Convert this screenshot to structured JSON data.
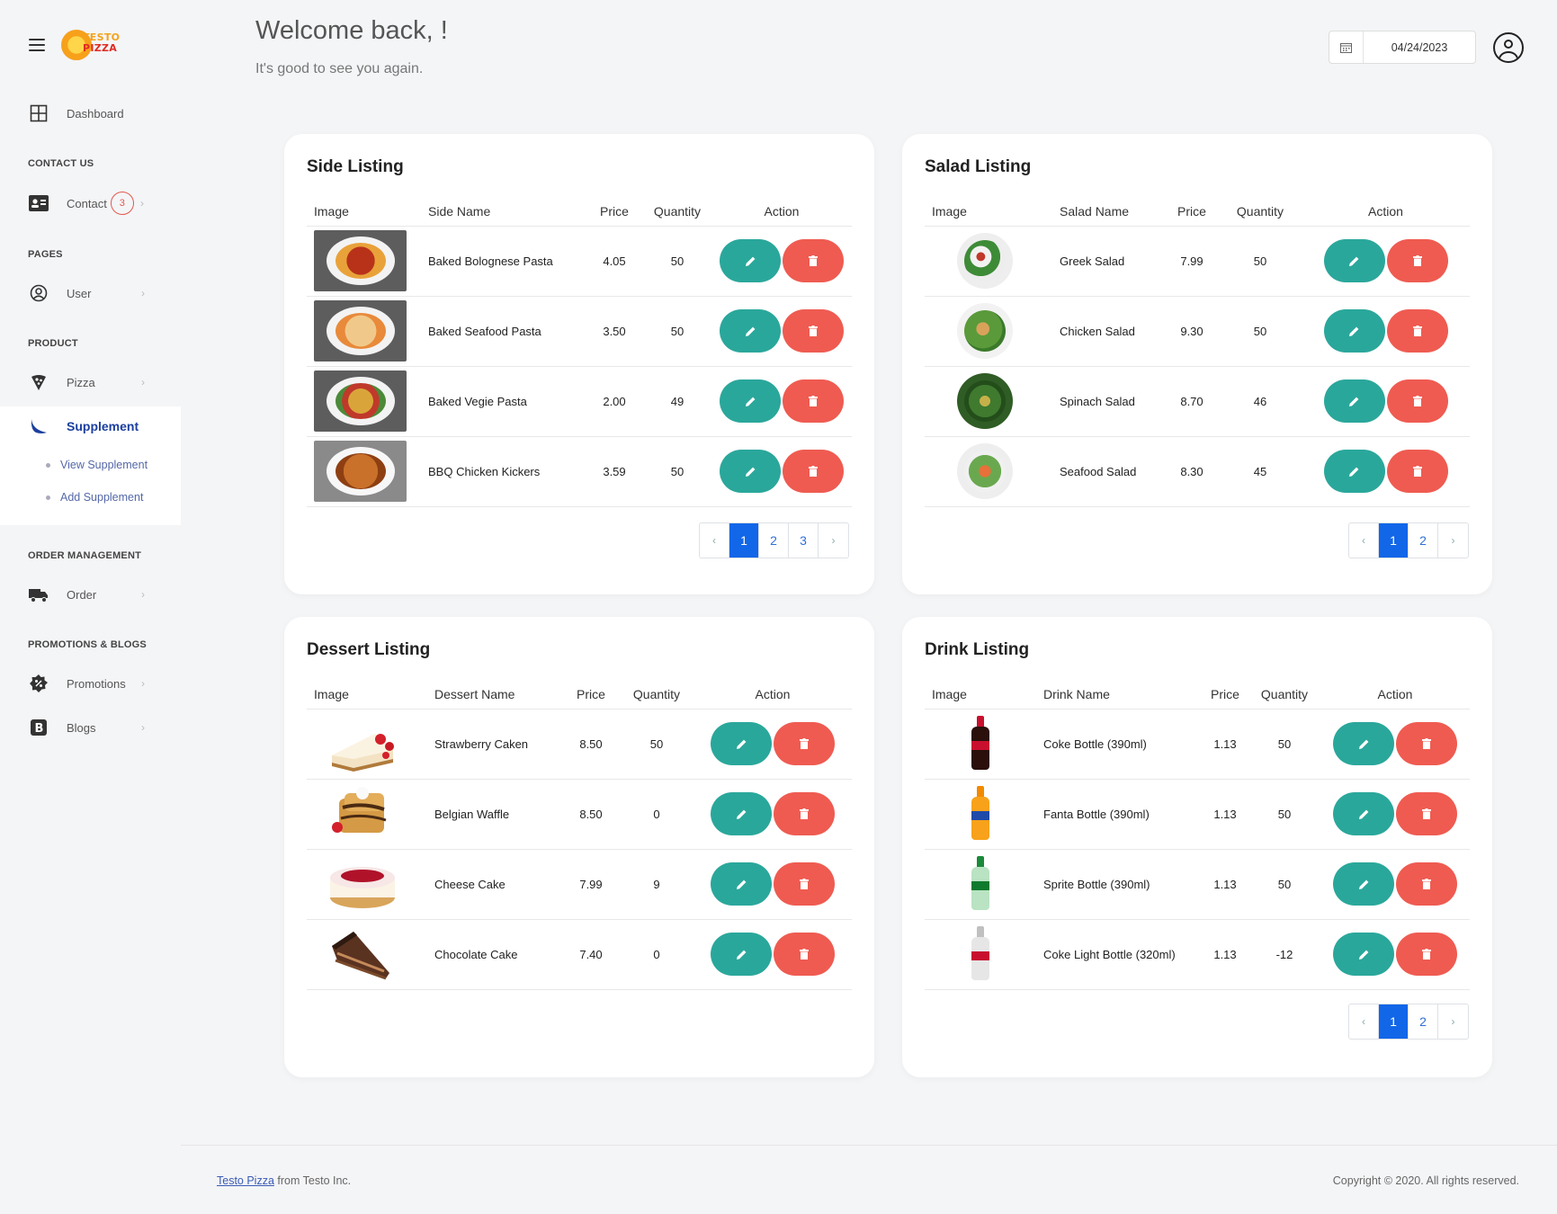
{
  "sidebar": {
    "logo_line1": "TESTO",
    "logo_line2": "PIZZA",
    "dashboard": "Dashboard",
    "section_contact": "CONTACT US",
    "contact": "Contact",
    "contact_badge": "3",
    "section_pages": "PAGES",
    "user": "User",
    "section_product": "PRODUCT",
    "pizza": "Pizza",
    "supplement": "Supplement",
    "view_supplement": "View Supplement",
    "add_supplement": "Add Supplement",
    "section_order": "ORDER MANAGEMENT",
    "order": "Order",
    "section_promo": "PROMOTIONS & BLOGS",
    "promotions": "Promotions",
    "blogs": "Blogs",
    "active_color": "#1c3f9e"
  },
  "header": {
    "welcome": "Welcome back, !",
    "subtitle": "It's good to see you again.",
    "date": "04/24/2023"
  },
  "side": {
    "title": "Side Listing",
    "headers": [
      "Image",
      "Side Name",
      "Price",
      "Quantity",
      "Action"
    ],
    "rows": [
      {
        "name": "Baked Bolognese Pasta",
        "price": "4.05",
        "qty": "50"
      },
      {
        "name": "Baked Seafood Pasta",
        "price": "3.50",
        "qty": "50"
      },
      {
        "name": "Baked Vegie Pasta",
        "price": "2.00",
        "qty": "49"
      },
      {
        "name": "BBQ Chicken Kickers",
        "price": "3.59",
        "qty": "50"
      }
    ],
    "pages": [
      "‹",
      "1",
      "2",
      "3",
      "›"
    ]
  },
  "salad": {
    "title": "Salad Listing",
    "headers": [
      "Image",
      "Salad Name",
      "Price",
      "Quantity",
      "Action"
    ],
    "rows": [
      {
        "name": "Greek Salad",
        "price": "7.99",
        "qty": "50"
      },
      {
        "name": "Chicken Salad",
        "price": "9.30",
        "qty": "50"
      },
      {
        "name": "Spinach Salad",
        "price": "8.70",
        "qty": "46"
      },
      {
        "name": "Seafood Salad",
        "price": "8.30",
        "qty": "45"
      }
    ],
    "pages": [
      "‹",
      "1",
      "2",
      "›"
    ]
  },
  "dessert": {
    "title": "Dessert Listing",
    "headers": [
      "Image",
      "Dessert Name",
      "Price",
      "Quantity",
      "Action"
    ],
    "rows": [
      {
        "name": "Strawberry Caken",
        "price": "8.50",
        "qty": "50"
      },
      {
        "name": "Belgian Waffle",
        "price": "8.50",
        "qty": "0"
      },
      {
        "name": "Cheese Cake",
        "price": "7.99",
        "qty": "9"
      },
      {
        "name": "Chocolate Cake",
        "price": "7.40",
        "qty": "0"
      }
    ]
  },
  "drink": {
    "title": "Drink Listing",
    "headers": [
      "Image",
      "Drink Name",
      "Price",
      "Quantity",
      "Action"
    ],
    "rows": [
      {
        "name": "Coke Bottle (390ml)",
        "price": "1.13",
        "qty": "50"
      },
      {
        "name": "Fanta Bottle (390ml)",
        "price": "1.13",
        "qty": "50"
      },
      {
        "name": "Sprite Bottle (390ml)",
        "price": "1.13",
        "qty": "50"
      },
      {
        "name": "Coke Light Bottle (320ml)",
        "price": "1.13",
        "qty": "-12"
      }
    ],
    "pages": [
      "‹",
      "1",
      "2",
      "›"
    ]
  },
  "footer": {
    "brand_link": "Testo Pizza",
    "brand_suffix": " from Testo Inc.",
    "copyright": "Copyright © 2020. All rights reserved."
  },
  "icons": {
    "edit": "pencil-icon",
    "delete": "trash-icon",
    "calendar": "calendar-icon",
    "profile": "user-circle-icon"
  },
  "colors": {
    "edit_button": "#2aa79b",
    "delete_button": "#ef5b51",
    "page_active": "#1266e8"
  }
}
